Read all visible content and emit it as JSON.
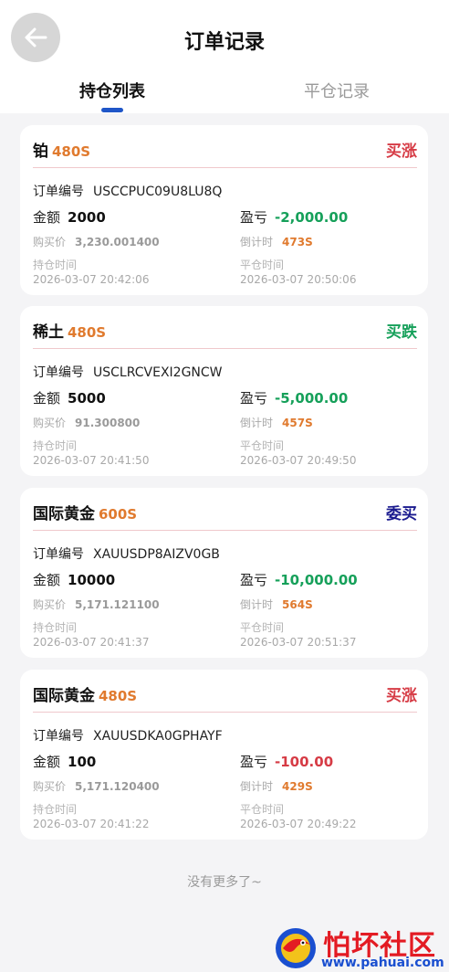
{
  "header": {
    "title": "订单记录",
    "back_icon": "arrow-left-icon"
  },
  "tabs": [
    {
      "label": "持仓列表",
      "active": true
    },
    {
      "label": "平仓记录",
      "active": false
    }
  ],
  "colors": {
    "buy_up": "#d63b45",
    "buy_down": "#16a05a",
    "commission": "#1b1b8f",
    "pnl_positive": "#16a05a",
    "pnl_negative": "#d63b45",
    "duration": "#e07a2e",
    "tab_indicator": "#1f56c8"
  },
  "labels": {
    "order_no": "订单编号",
    "amount": "金额",
    "pnl": "盈亏",
    "buy_price": "购买价",
    "countdown": "倒计时",
    "open_time": "持仓时间",
    "close_time": "平仓时间"
  },
  "orders": [
    {
      "product": "铂",
      "duration": "480S",
      "direction": "买涨",
      "direction_color": "#d63b45",
      "order_no": "USCCPUC09U8LU8Q",
      "amount": "2000",
      "pnl": "-2,000.00",
      "pnl_color": "#16a05a",
      "buy_price": "3,230.001400",
      "countdown": "473S",
      "open_time": "2026-03-07 20:42:06",
      "close_time": "2026-03-07 20:50:06"
    },
    {
      "product": "稀土",
      "duration": "480S",
      "direction": "买跌",
      "direction_color": "#16a05a",
      "order_no": "USCLRCVEXI2GNCW",
      "amount": "5000",
      "pnl": "-5,000.00",
      "pnl_color": "#16a05a",
      "buy_price": "91.300800",
      "countdown": "457S",
      "open_time": "2026-03-07 20:41:50",
      "close_time": "2026-03-07 20:49:50"
    },
    {
      "product": "国际黄金",
      "duration": "600S",
      "direction": "委买",
      "direction_color": "#1b1b8f",
      "order_no": "XAUUSDP8AIZV0GB",
      "amount": "10000",
      "pnl": "-10,000.00",
      "pnl_color": "#16a05a",
      "buy_price": "5,171.121100",
      "countdown": "564S",
      "open_time": "2026-03-07 20:41:37",
      "close_time": "2026-03-07 20:51:37"
    },
    {
      "product": "国际黄金",
      "duration": "480S",
      "direction": "买涨",
      "direction_color": "#d63b45",
      "order_no": "XAUUSDKA0GPHAYF",
      "amount": "100",
      "pnl": "-100.00",
      "pnl_color": "#d63b45",
      "buy_price": "5,171.120400",
      "countdown": "429S",
      "open_time": "2026-03-07 20:41:22",
      "close_time": "2026-03-07 20:49:22"
    }
  ],
  "footer": {
    "no_more": "没有更多了~"
  },
  "watermark": {
    "name": "怕坏社区",
    "url": "www.pahuai.com",
    "logo_icon": "pahuai-logo-icon"
  }
}
